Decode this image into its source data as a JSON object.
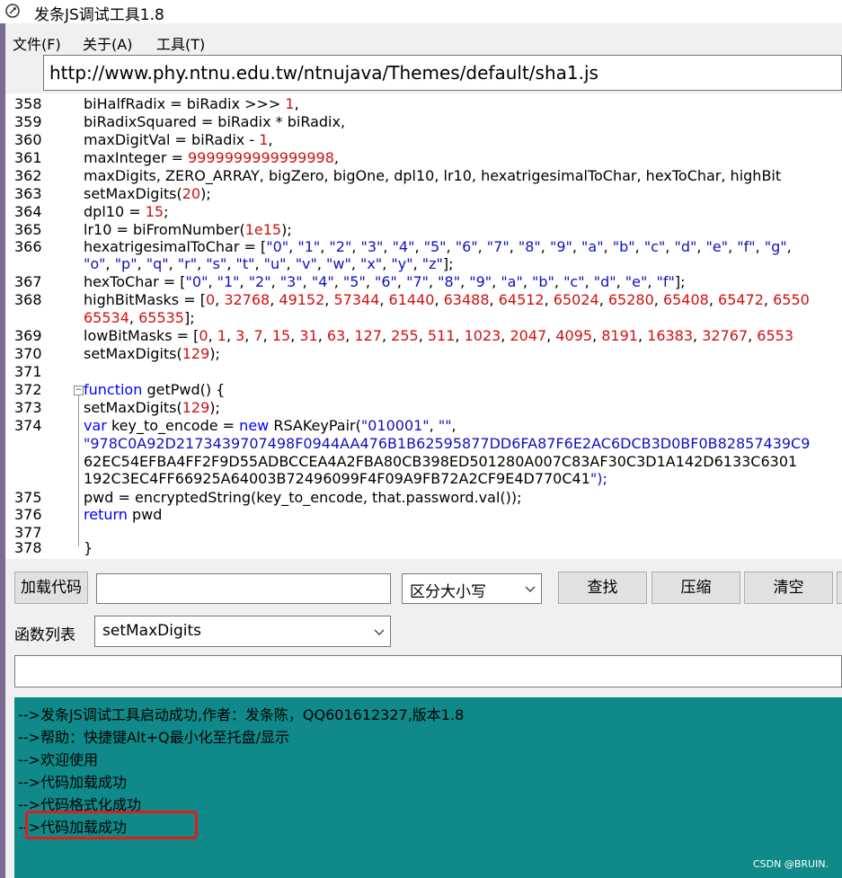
{
  "window": {
    "title": "发条JS调试工具1.8",
    "icon": "app-icon"
  },
  "menu": {
    "items": [
      {
        "label": "文件(F)"
      },
      {
        "label": "关于(A)"
      },
      {
        "label": "工具(T)"
      }
    ]
  },
  "url": {
    "value": "http://www.phy.ntnu.edu.tw/ntnujava/Themes/default/sha1.js"
  },
  "code": {
    "lines": [
      {
        "n": "358",
        "text": "biHalfRadix = biRadix >>> 1,"
      },
      {
        "n": "359",
        "text": "biRadixSquared = biRadix * biRadix,"
      },
      {
        "n": "360",
        "text": "maxDigitVal = biRadix - 1,"
      },
      {
        "n": "361",
        "text": "maxInteger = 9999999999999998,"
      },
      {
        "n": "362",
        "text": "maxDigits, ZERO_ARRAY, bigZero, bigOne, dpl10, lr10, hexatrigesimalToChar, hexToChar, highBit"
      },
      {
        "n": "363",
        "text": "setMaxDigits(20);"
      },
      {
        "n": "364",
        "text": "dpl10 = 15;"
      },
      {
        "n": "365",
        "text": "lr10 = biFromNumber(1e15);"
      },
      {
        "n": "366",
        "text": "hexatrigesimalToChar = [\"0\", \"1\", \"2\", \"3\", \"4\", \"5\", \"6\", \"7\", \"8\", \"9\", \"a\", \"b\", \"c\", \"d\", \"e\", \"f\", \"g\","
      },
      {
        "n": "",
        "text": "\"o\", \"p\", \"q\", \"r\", \"s\", \"t\", \"u\", \"v\", \"w\", \"x\", \"y\", \"z\"];"
      },
      {
        "n": "367",
        "text": "hexToChar = [\"0\", \"1\", \"2\", \"3\", \"4\", \"5\", \"6\", \"7\", \"8\", \"9\", \"a\", \"b\", \"c\", \"d\", \"e\", \"f\"];"
      },
      {
        "n": "368",
        "text": "highBitMasks = [0, 32768, 49152, 57344, 61440, 63488, 64512, 65024, 65280, 65408, 65472, 6550"
      },
      {
        "n": "",
        "text": "65534, 65535];"
      },
      {
        "n": "369",
        "text": "lowBitMasks = [0, 1, 3, 7, 15, 31, 63, 127, 255, 511, 1023, 2047, 4095, 8191, 16383, 32767, 6553"
      },
      {
        "n": "370",
        "text": "setMaxDigits(129);"
      },
      {
        "n": "371",
        "text": ""
      },
      {
        "n": "372",
        "text": "function getPwd() {"
      },
      {
        "n": "373",
        "text": "setMaxDigits(129);"
      },
      {
        "n": "374",
        "text": "var key_to_encode = new RSAKeyPair(\"010001\", \"\","
      },
      {
        "n": "",
        "text": "\"978C0A92D2173439707498F0944AA476B1B62595877DD6FA87F6E2AC6DCB3D0BF0B82857439C9"
      },
      {
        "n": "",
        "text": "62EC54EFBA4FF2F9D55ADBCCEA4A2FBA80CB398ED501280A007C83AF30C3D1A142D6133C6301"
      },
      {
        "n": "",
        "text": "192C3EC4FF66925A64003B72496099F4F09A9FB72A2CF9E4D770C41\");"
      },
      {
        "n": "375",
        "text": "pwd = encryptedString(key_to_encode, that.password.val());"
      },
      {
        "n": "376",
        "text": "return pwd"
      },
      {
        "n": "377",
        "text": ""
      },
      {
        "n": "378",
        "text": "}"
      }
    ]
  },
  "toolbar": {
    "load_label": "加载代码",
    "load_input_value": "",
    "case_select_value": "区分大小写",
    "find_label": "查找",
    "compress_label": "压缩",
    "clear_label": "清空"
  },
  "functions": {
    "label": "函数列表",
    "selected": "setMaxDigits"
  },
  "console": {
    "lines": [
      "-->发条JS调试工具启动成功,作者：发条陈，QQ601612327,版本1.8",
      "-->帮助：快捷键Alt+Q最小化至托盘/显示",
      "-->欢迎使用",
      "-->代码加载成功",
      "-->代码格式化成功",
      "-->代码加载成功"
    ],
    "background": "#0f8989",
    "highlight_color": "#e21a1a"
  },
  "watermark": "CSDN @BRUIN."
}
